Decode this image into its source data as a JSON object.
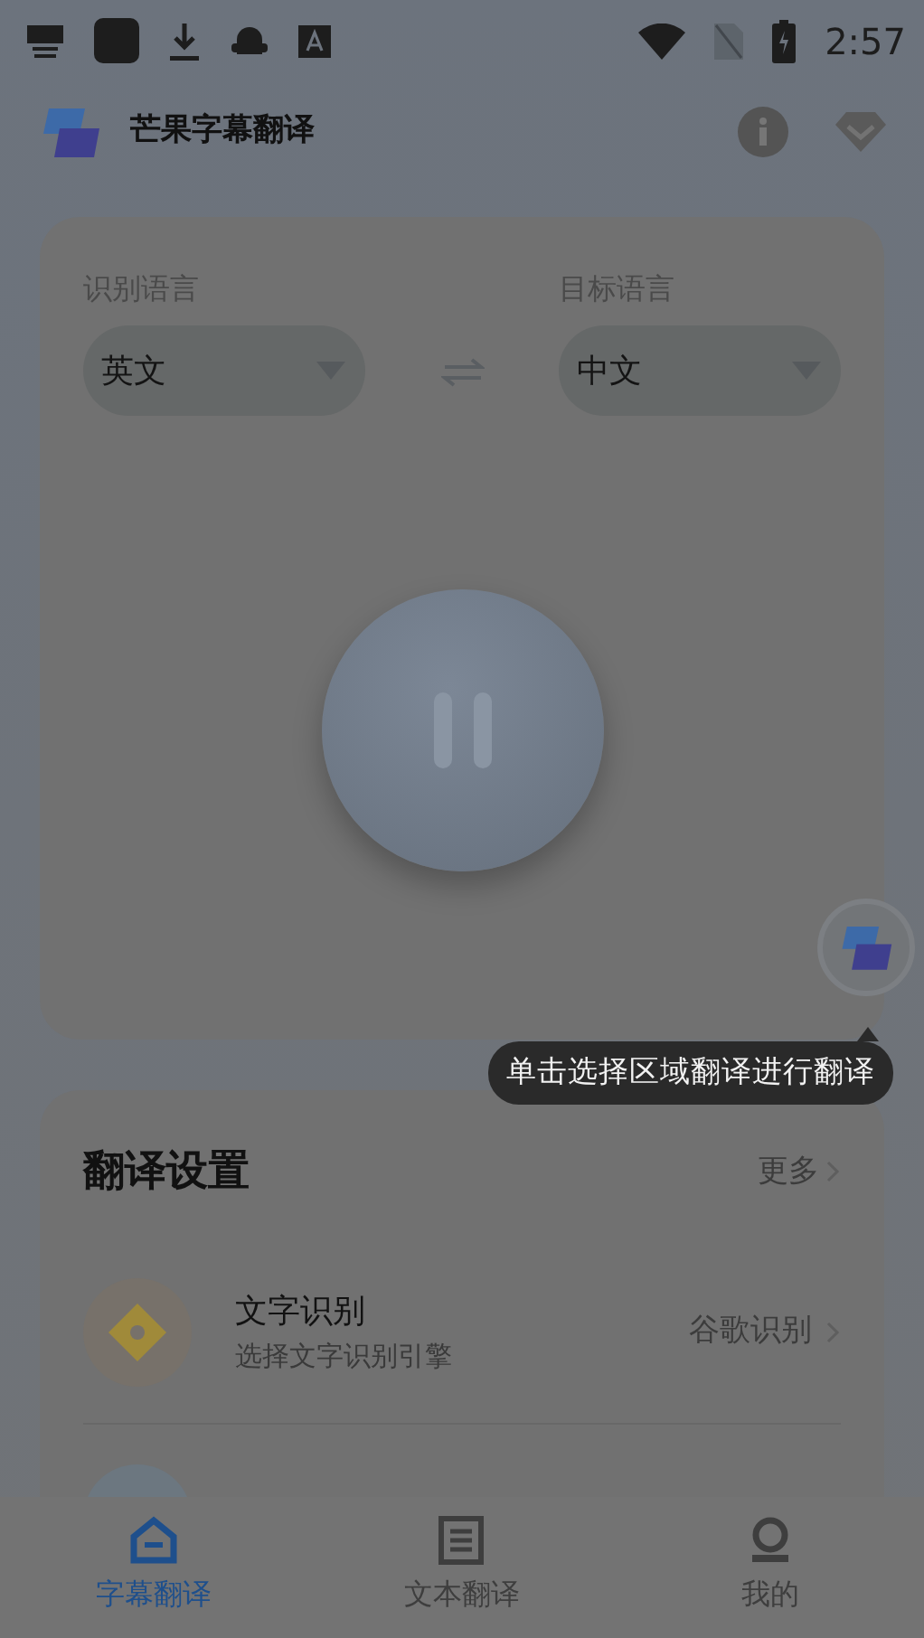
{
  "status_bar": {
    "time": "2:57"
  },
  "app_bar": {
    "title": "芒果字幕翻译"
  },
  "language_panel": {
    "source": {
      "label": "识别语言",
      "value": "英文"
    },
    "target": {
      "label": "目标语言",
      "value": "中文"
    }
  },
  "tooltip": "单击选择区域翻译进行翻译",
  "settings": {
    "title": "翻译设置",
    "more": "更多",
    "items": [
      {
        "kind": "ocr",
        "title": "文字识别",
        "subtitle": "选择文字识别引擎",
        "value": "谷歌识别"
      },
      {
        "kind": "mode"
      }
    ]
  },
  "tabs": [
    {
      "kind": "home",
      "label": "字幕翻译",
      "selected": true
    },
    {
      "kind": "doc",
      "label": "文本翻译",
      "selected": false
    },
    {
      "kind": "user",
      "label": "我的",
      "selected": false
    }
  ]
}
